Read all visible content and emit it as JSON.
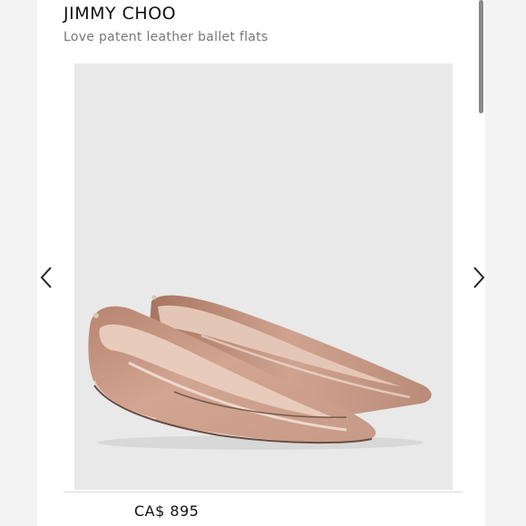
{
  "product": {
    "brand": "JIMMY CHOO",
    "name": "Love patent leather ballet flats",
    "price": "CA$ 895"
  },
  "gallery": {
    "image": "nude-pointed-ballet-flats",
    "background_color": "#e9e9e9",
    "prev_icon": "chevron-left-icon",
    "next_icon": "chevron-right-icon"
  },
  "colors": {
    "shoe": "#c89a86",
    "shoe_highlight": "#f1ddd3",
    "lining": "#e2c0ae"
  }
}
